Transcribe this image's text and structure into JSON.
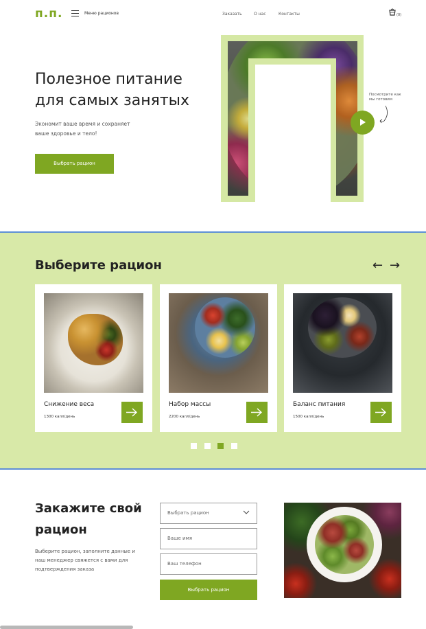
{
  "header": {
    "logo": "п.п.",
    "menu_label": "Меню рационов",
    "nav": [
      "Заказать",
      "О нас",
      "Контакты"
    ],
    "cart_count": "(0)",
    "icons": {
      "menu": "hamburger-icon",
      "cart": "basket-icon"
    }
  },
  "hero": {
    "title": "Полезное питание для самых занятых",
    "subtitle": "Экономит ваше время и сохраняет ваше здоровье и тело!",
    "button": "Выбрать рацион",
    "watch_label": "Посмотрите как мы готовим"
  },
  "rations": {
    "title": "Выберите рацион",
    "prev": "←",
    "next": "→",
    "cards": [
      {
        "name": "Снижение веса",
        "kcal": "1300 калл/день"
      },
      {
        "name": "Набор массы",
        "kcal": "2200 калл/день"
      },
      {
        "name": "Баланс питания",
        "kcal": "1500 калл/день"
      }
    ],
    "dots": 4,
    "active_dot": 3
  },
  "order": {
    "title": "Закажите свой рацион",
    "subtitle": "Выберите рацион, заполните данные и наш менеджер свяжется с вами для подтверждения заказа",
    "select_value": "Выбрать рацион",
    "name_placeholder": "Ваше имя",
    "phone_placeholder": "Ваш телефон",
    "button": "Выбрать рацион"
  },
  "colors": {
    "accent": "#7fa722",
    "light_green": "#d8e9a8",
    "frame_green": "#d5e8a4",
    "divider_blue": "#5d8ed6"
  }
}
